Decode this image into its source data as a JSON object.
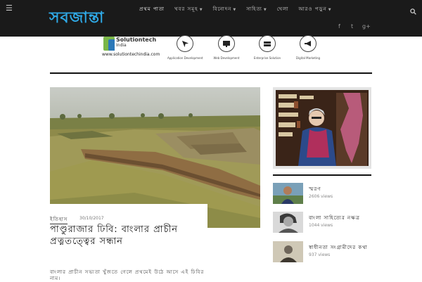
{
  "header": {
    "logo": "সবজান্তা",
    "nav": [
      {
        "label": "প্রথম পাতা",
        "dropdown": false
      },
      {
        "label": "খবর সমূহ",
        "dropdown": true
      },
      {
        "label": "বিনোদন",
        "dropdown": true
      },
      {
        "label": "সাহিত্য",
        "dropdown": true
      },
      {
        "label": "খেলা",
        "dropdown": false
      },
      {
        "label": "আরও পড়ুন",
        "dropdown": true
      }
    ],
    "social": [
      "f",
      "t",
      "g+"
    ],
    "icons": {
      "menu": "menu-icon",
      "search": "search-icon"
    }
  },
  "banner": {
    "brand_name": "Solutiontech",
    "brand_sub": "India",
    "url": "www.solutiontechindia.com",
    "services": [
      {
        "label": "Application Development",
        "icon": "cursor-icon"
      },
      {
        "label": "Web Development",
        "icon": "monitor-icon"
      },
      {
        "label": "Enterprise Solution",
        "icon": "server-icon"
      },
      {
        "label": "Digital Marketing",
        "icon": "megaphone-icon"
      }
    ]
  },
  "featured": {
    "category": "ইতিহাস",
    "date": "30/10/2017",
    "title": "পাণ্ডুরাজার ঢিবি: বাংলার প্রাচীন প্রত্নতত্ত্বের সন্ধান",
    "excerpt": "বাংলার প্রাচীন সভ্যতা খুঁজতে গেলে প্রথমেই উঠে আসে এই ঢিবির নাম।"
  },
  "sidebar": {
    "items": [
      {
        "title": "স্মরণ",
        "views": "2606 views"
      },
      {
        "title": "বাংলা সাহিত্যের নক্ষত্র",
        "views": "1044 views"
      },
      {
        "title": "স্বাধীনতা সংগ্রামীদের কথা",
        "views": "937 views"
      }
    ]
  },
  "colors": {
    "accent": "#2fa9e6",
    "topbar": "#1a1a1a"
  }
}
